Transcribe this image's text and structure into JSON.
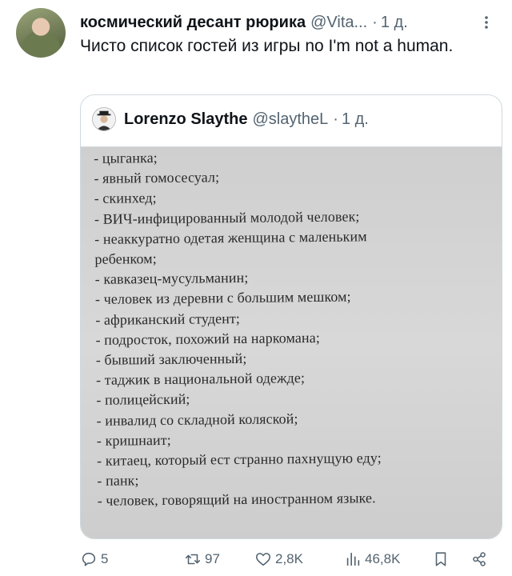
{
  "tweet": {
    "display_name": "космический десант рюрика",
    "handle": "@Vita...",
    "separator": "·",
    "time": "1 д.",
    "text": "Чисто список гостей из игры no I'm not a human."
  },
  "quote": {
    "display_name": "Lorenzo Slaythe",
    "handle": "@slaytheL",
    "separator": "·",
    "time": "1 д.",
    "image_lines": [
      "- цыганка;",
      "- явный гомосесуал;",
      "- скинхед;",
      "- ВИЧ-инфицированный молодой человек;",
      "- неаккуратно одетая женщина с маленьким",
      "ребенком;",
      "- кавказец-мусульманин;",
      "- человек из деревни с большим мешком;",
      "- африканский студент;",
      "- подросток, похожий на наркомана;",
      "- бывший заключенный;",
      "- таджик в национальной одежде;",
      "- полицейский;",
      "- инвалид со складной коляской;",
      "- кришнаит;",
      "- китаец, который ест странно пахнущую еду;",
      "- панк;",
      "- человек, говорящий на иностранном языке."
    ]
  },
  "actions": {
    "replies": "5",
    "reposts": "97",
    "likes": "2,8K",
    "views": "46,8K"
  },
  "icons": {
    "more": "more-dots-icon",
    "reply": "reply-bubble-icon",
    "repost": "repost-icon",
    "like": "heart-icon",
    "views": "views-bars-icon",
    "bookmark": "bookmark-icon",
    "share": "share-icon"
  },
  "colors": {
    "text": "#0f1419",
    "muted": "#536471",
    "border": "#cfd9de"
  }
}
